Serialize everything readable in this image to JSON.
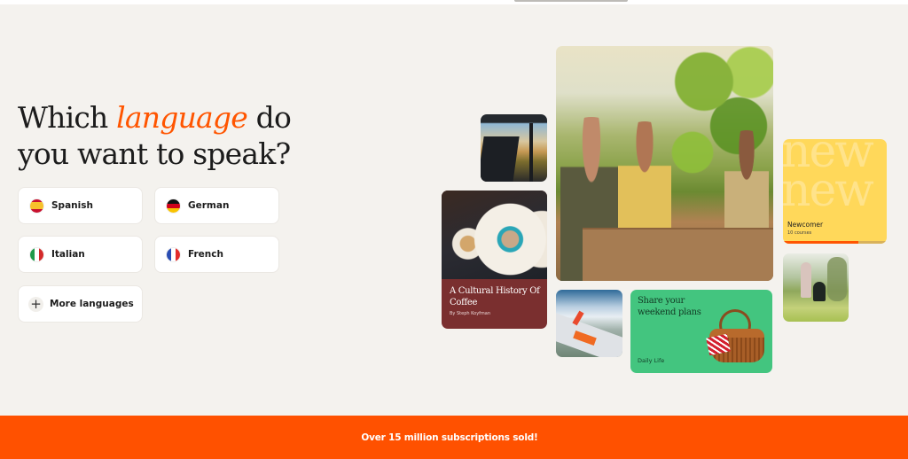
{
  "hero": {
    "headline_before": "Which ",
    "headline_accent": "language",
    "headline_after": " do you want to speak?",
    "accent_color": "#ff5500"
  },
  "languages": [
    {
      "label": "Spanish",
      "icon": "spain-flag-icon"
    },
    {
      "label": "German",
      "icon": "germany-flag-icon"
    },
    {
      "label": "Italian",
      "icon": "italy-flag-icon"
    },
    {
      "label": "French",
      "icon": "france-flag-icon"
    }
  ],
  "more_languages": {
    "label": "More languages",
    "icon": "plus-icon"
  },
  "cards": {
    "coffee": {
      "title": "A Cultural History Of Coffee",
      "author": "By Steph Koyfman",
      "color": "#7a2f2f"
    },
    "newcomer": {
      "bg_word": "new new",
      "title": "Newcomer",
      "count": "10 courses",
      "progress": 0.73,
      "color": "#ffd85a"
    },
    "weekend": {
      "title": "Share your weekend plans",
      "tag": "Daily Life",
      "color": "#43c57f"
    }
  },
  "photos": [
    "car-window-photo",
    "friends-at-table-photo",
    "airplane-wing-photo",
    "garden-photo"
  ],
  "banner": {
    "text": "Over 15 million subscriptions sold!",
    "color": "#ff5100"
  }
}
